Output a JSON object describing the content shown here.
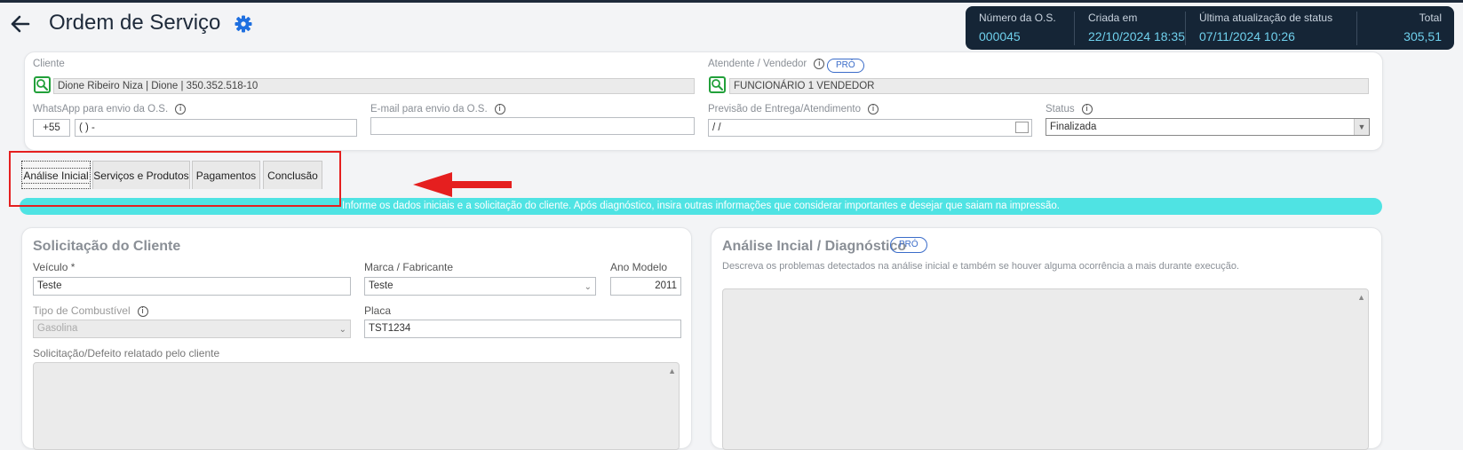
{
  "header": {
    "title": "Ordem de Serviço",
    "summary": [
      {
        "label": "Número da O.S.",
        "value": "000045"
      },
      {
        "label": "Criada em",
        "value": "22/10/2024 18:35"
      },
      {
        "label": "Última atualização de status",
        "value": "07/11/2024 10:26"
      },
      {
        "label": "Total",
        "value": "305,51"
      }
    ]
  },
  "form": {
    "cliente_label": "Cliente",
    "cliente_value": "Dione Ribeiro Niza | Dione | 350.352.518-10",
    "atendente_label": "Atendente / Vendedor",
    "atendente_badge": "PRÓ",
    "atendente_value": "FUNCIONÁRIO 1 VENDEDOR",
    "whatsapp_label": "WhatsApp para envio da O.S.",
    "whatsapp_ddi": "+55",
    "whatsapp_value": "( )   -",
    "email_label": "E-mail para envio da O.S.",
    "email_value": "",
    "previsao_label": "Previsão de Entrega/Atendimento",
    "previsao_value": "/ /",
    "status_label": "Status",
    "status_value": "Finalizada"
  },
  "tabs": [
    {
      "label": "Análise Inicial"
    },
    {
      "label": "Serviços e Produtos"
    },
    {
      "label": "Pagamentos"
    },
    {
      "label": "Conclusão"
    }
  ],
  "hint": "Informe os dados iniciais e a solicitação do cliente. Após diagnóstico, insira outras informações que considerar importantes e desejar que saiam na impressão.",
  "solicitacao": {
    "title": "Solicitação do Cliente",
    "veiculo_label": "Veículo *",
    "veiculo_value": "Teste",
    "marca_label": "Marca / Fabricante",
    "marca_value": "Teste",
    "ano_label": "Ano Modelo",
    "ano_value": "2011",
    "combustivel_label": "Tipo de Combustível",
    "combustivel_value": "Gasolina",
    "placa_label": "Placa",
    "placa_value": "TST1234",
    "defeito_label": "Solicitação/Defeito relatado pelo cliente"
  },
  "analise": {
    "title": "Análise Incial / Diagnóstico",
    "badge": "PRÓ",
    "desc": "Descreva os problemas detectados na análise inicial e também se houver alguma ocorrência a mais durante execução."
  },
  "info_glyph": "i",
  "colors": {
    "accent": "#1e6fe0",
    "brand_dark": "#152536",
    "highlight": "#e51f1f",
    "hint_bar": "#4fe3e3",
    "search_green": "#22a03a"
  }
}
